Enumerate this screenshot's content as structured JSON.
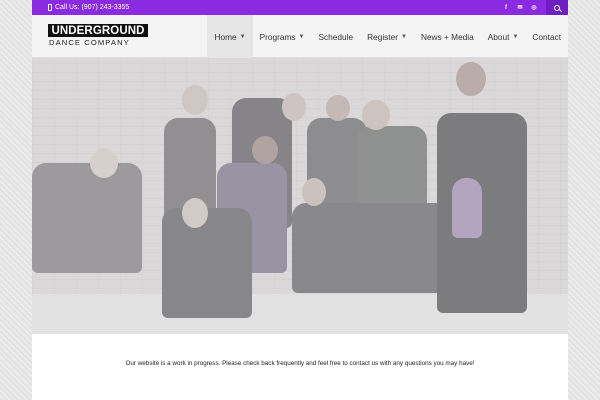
{
  "topbar": {
    "phone": "Call Us: (907) 243-3355",
    "social": [
      "f",
      "✉",
      "◎"
    ]
  },
  "logo": {
    "line1": "UNDERGROUND",
    "line2": "DANCE COMPANY"
  },
  "nav": [
    {
      "label": "Home",
      "has_menu": true
    },
    {
      "label": "Programs",
      "has_menu": true
    },
    {
      "label": "Schedule",
      "has_menu": false
    },
    {
      "label": "Register",
      "has_menu": true
    },
    {
      "label": "News + Media",
      "has_menu": false
    },
    {
      "label": "About",
      "has_menu": true
    },
    {
      "label": "Contact",
      "has_menu": false
    }
  ],
  "colors": {
    "accent": "#8a2be2"
  },
  "content": {
    "notice": "Our website is a work in progress. Please check back frequently and feel free to contact us with any questions you may have!"
  }
}
